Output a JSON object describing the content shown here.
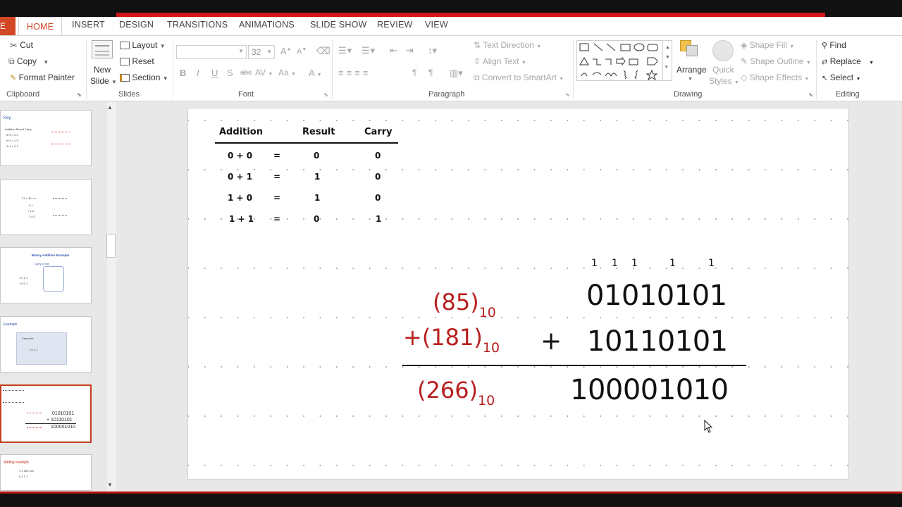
{
  "tabs": {
    "file": "E",
    "active": "HOME",
    "others": [
      "INSERT",
      "DESIGN",
      "TRANSITIONS",
      "ANIMATIONS",
      "SLIDE SHOW",
      "REVIEW",
      "VIEW"
    ]
  },
  "ribbon": {
    "clipboard": {
      "cut": "Cut",
      "copy": "Copy",
      "format_painter": "Format Painter",
      "label": "Clipboard"
    },
    "slides": {
      "new_slide_1": "New",
      "new_slide_2": "Slide",
      "layout": "Layout",
      "reset": "Reset",
      "section": "Section",
      "label": "Slides"
    },
    "font": {
      "size": "32",
      "label": "Font",
      "bold": "B",
      "italic": "I",
      "underline": "U",
      "shadow": "S",
      "strike": "abc",
      "spacing": "AV",
      "case": "Aa",
      "color": "A"
    },
    "paragraph": {
      "text_direction": "Text Direction",
      "align_text": "Align Text",
      "convert_smartart": "Convert to SmartArt",
      "label": "Paragraph"
    },
    "drawing": {
      "arrange": "Arrange",
      "quick_styles_1": "Quick",
      "quick_styles_2": "Styles",
      "shape_fill": "Shape Fill",
      "shape_outline": "Shape Outline",
      "shape_effects": "Shape Effects",
      "label": "Drawing"
    },
    "editing": {
      "find": "Find",
      "replace": "Replace",
      "select": "Select",
      "label": "Editing"
    }
  },
  "thumbnails": [
    {
      "title": "Key",
      "lines": [
        "Addition  Result  Carry",
        "0+0 = 0 0",
        "0+1 = 1 0",
        "1+1 = 0 1"
      ]
    },
    {
      "title": "",
      "lines": [
        "21 + 10 = e",
        "0 1",
        "+ 1 0",
        "1 0 0"
      ]
    },
    {
      "title": "Binary Addition Example",
      "lines": [
        "Carry of the",
        "1 0 1 1",
        "1 0 0 1"
      ]
    },
    {
      "title": "Example",
      "lines": [
        "Carry the",
        "1 0 1 1"
      ]
    },
    {
      "title": "",
      "lines": [
        "01010101",
        "+ 10110101",
        "100001010"
      ]
    },
    {
      "title": "Adding example",
      "lines": [
        "1  1  100  101",
        "0  1  1  1"
      ]
    }
  ],
  "slide": {
    "table": {
      "headers": [
        "Addition",
        "Result",
        "Carry"
      ],
      "rows": [
        [
          "0 + 0",
          "=",
          "0",
          "0"
        ],
        [
          "0 + 1",
          "=",
          "1",
          "0"
        ],
        [
          "1 + 0",
          "=",
          "1",
          "0"
        ],
        [
          "1 + 1",
          "=",
          "0",
          "1"
        ]
      ]
    },
    "carries": [
      "1",
      "1",
      "1",
      "1",
      "1"
    ],
    "decimal": {
      "a": "(85)",
      "a_sub": "10",
      "b": "+(181)",
      "b_sub": "10",
      "sum": "(266)",
      "sum_sub": "10"
    },
    "binary": {
      "a": "01010101",
      "plus": "+",
      "b": "10110101",
      "sum": "100001010"
    }
  }
}
